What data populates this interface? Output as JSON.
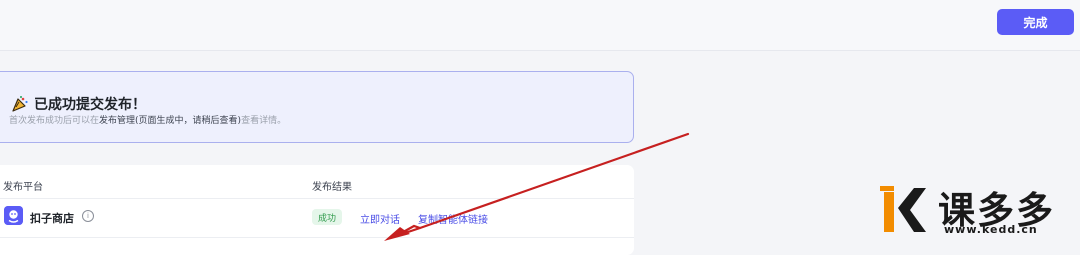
{
  "header": {
    "done_label": "完成"
  },
  "notice": {
    "icon": "party-popper-icon",
    "title": "已成功提交发布！",
    "desc_prefix": "首次发布成功后可以在",
    "desc_link": "发布管理",
    "desc_paren": "(页面生成中，请稍后查看)",
    "desc_suffix": "查看详情。"
  },
  "results": {
    "columns": [
      "发布平台",
      "发布结果"
    ],
    "rows": [
      {
        "platform": "扣子商店",
        "status": "成功",
        "actions": [
          "立即对话",
          "复制智能体链接"
        ]
      }
    ]
  },
  "watermark": {
    "brand": "课多多",
    "url": "www.kedd.cn"
  },
  "colors": {
    "accent": "#5b5cf6",
    "success_bg": "#e5f6ea",
    "success_text": "#2f9a4b",
    "annotation_arrow": "#c62020"
  }
}
